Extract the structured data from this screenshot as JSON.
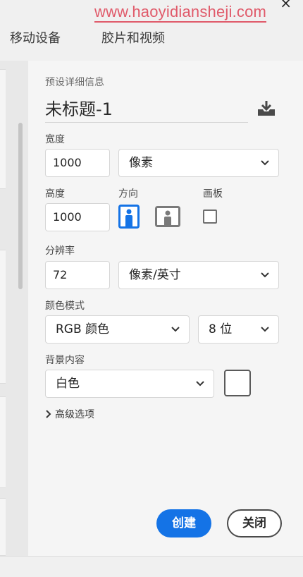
{
  "watermark": "www.haoyidiansheji.com",
  "window": {
    "close_glyph": "×"
  },
  "tabs": [
    {
      "label": "移动设备"
    },
    {
      "label": "胶片和视频"
    }
  ],
  "preset": {
    "section_label": "预设详细信息",
    "name": "未标题-1",
    "save_icon": "save-preset-icon"
  },
  "width": {
    "label": "宽度",
    "value": "1000",
    "unit": "像素"
  },
  "height": {
    "label": "高度",
    "value": "1000"
  },
  "orientation": {
    "label": "方向",
    "options": [
      "portrait",
      "landscape"
    ],
    "selected": "portrait"
  },
  "artboard": {
    "label": "画板",
    "checked": false
  },
  "resolution": {
    "label": "分辨率",
    "value": "72",
    "unit": "像素/英寸"
  },
  "color_mode": {
    "label": "颜色模式",
    "mode": "RGB 颜色",
    "depth": "8 位"
  },
  "background": {
    "label": "背景内容",
    "value": "白色",
    "swatch_color": "#ffffff"
  },
  "advanced": {
    "label": "高级选项"
  },
  "actions": {
    "create": "创建",
    "close": "关闭"
  },
  "colors": {
    "accent": "#1473e6",
    "watermark": "#e05a6a"
  }
}
